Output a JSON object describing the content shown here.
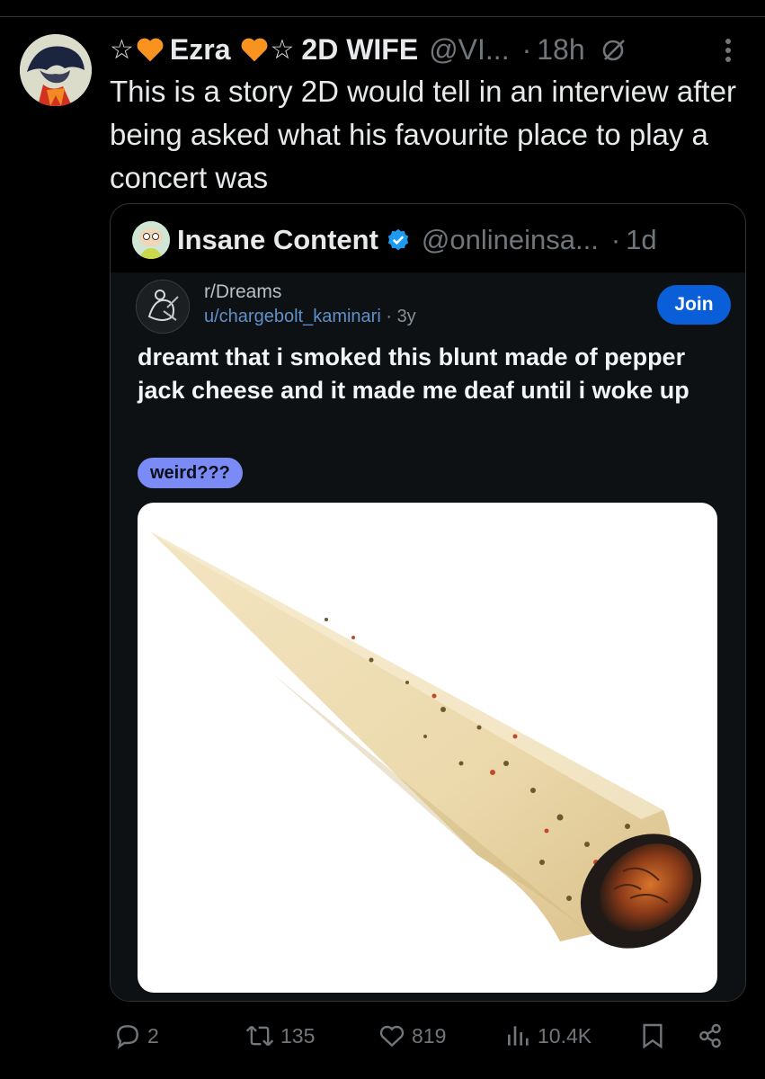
{
  "tweet": {
    "prefix_star": "☆",
    "display_name": "Ezra",
    "suffix_star": "☆",
    "name_tag": "2D WIFE",
    "handle": "@VI...",
    "time": "18h",
    "text": "This is a story 2D would tell in an interview after being asked what his favourite place to play a concert was"
  },
  "quote": {
    "name": "Insane Content",
    "handle": "@onlineinsa...",
    "time": "1d",
    "reddit": {
      "subreddit": "r/Dreams",
      "user": "u/chargebolt_kaminari",
      "age": "3y",
      "join_label": "Join",
      "title": "dreamt that i smoked this blunt made of pepper jack cheese and it made me deaf until i woke up",
      "flair": "weird???"
    }
  },
  "actions": {
    "replies": "2",
    "reposts": "135",
    "likes": "819",
    "views": "10.4K"
  },
  "colors": {
    "background": "#000000",
    "muted": "#71767b",
    "verified": "#1d9bf0",
    "join": "#0a5fd8",
    "flair": "#7a8bf5",
    "heart": "#f7931e"
  },
  "icons": [
    "heart-icon",
    "grok-icon",
    "more-icon",
    "verified-icon",
    "reply-icon",
    "repost-icon",
    "like-icon",
    "views-icon",
    "bookmark-icon",
    "share-icon"
  ]
}
